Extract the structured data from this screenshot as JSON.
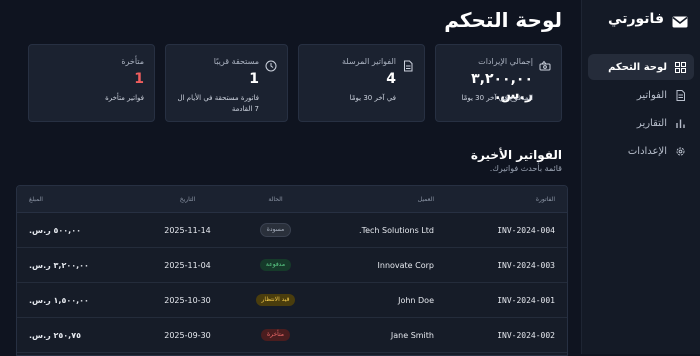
{
  "app": {
    "title": "فاتورتي",
    "nav": [
      {
        "label": "لوحة التحكم",
        "icon": "grid-icon",
        "active": true
      },
      {
        "label": "الفواتير",
        "icon": "document-icon"
      },
      {
        "label": "التقارير",
        "icon": "bar-chart-icon"
      },
      {
        "label": "الإعدادات",
        "icon": "gear-icon"
      }
    ]
  },
  "page": {
    "title": "لوحة التحكم"
  },
  "stats": [
    {
      "label": "إجمالي الإيرادات",
      "value": "٣,٢٠٠,٠٠ ر.س.",
      "sub": "المدفوع في آخر 30 يومًا",
      "icon": "money-icon"
    },
    {
      "label": "الفواتير المرسلة",
      "value": "4",
      "sub": "في آخر 30 يومًا",
      "icon": "file-icon"
    },
    {
      "label": "مستحقة قريبًا",
      "value": "1",
      "sub": "فاتورة مستحقة في الأيام ال 7 القادمة",
      "icon": "clock-icon"
    },
    {
      "label": "متأخرة",
      "value": "1",
      "sub": "فواتير متأخرة",
      "color": "#ef5d5d"
    }
  ],
  "recent": {
    "title": "الفواتير الأخيرة",
    "subtitle": "قائمة بأحدث فواتيرك.",
    "columns": {
      "invoice": "الفاتورة",
      "client": "العميل",
      "status": "الحالة",
      "date": "التاريخ",
      "amount": "المبلغ"
    },
    "rows": [
      {
        "invoice": "INV-2024-004",
        "client": "Tech Solutions Ltd.",
        "status": "مسودة",
        "status_type": "draft",
        "date": "2025-11-14",
        "amount": "٥٠٠,٠٠ ر.س."
      },
      {
        "invoice": "INV-2024-003",
        "client": "Innovate Corp",
        "status": "مدفوعة",
        "status_type": "paid",
        "date": "2025-11-04",
        "amount": "٣,٢٠٠,٠٠ ر.س."
      },
      {
        "invoice": "INV-2024-001",
        "client": "John Doe",
        "status": "قيد الانتظار",
        "status_type": "pending",
        "date": "2025-10-30",
        "amount": "١,٥٠٠,٠٠ ر.س."
      },
      {
        "invoice": "INV-2024-002",
        "client": "Jane Smith",
        "status": "متأخرة",
        "status_type": "overdue",
        "date": "2025-09-30",
        "amount": "٢٥٠,٧٥ ر.س."
      }
    ]
  }
}
